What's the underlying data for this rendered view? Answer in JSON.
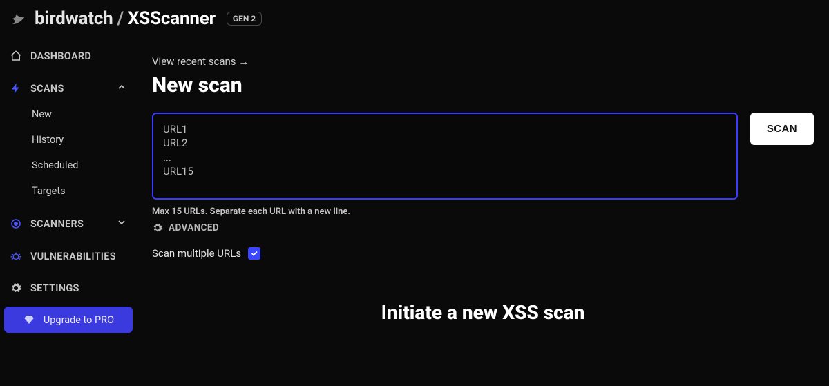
{
  "header": {
    "owner": "birdwatch",
    "separator": "/",
    "project": "XSScanner",
    "badge": "GEN 2"
  },
  "sidebar": {
    "dashboard": "DASHBOARD",
    "scans": {
      "label": "SCANS",
      "items": [
        "New",
        "History",
        "Scheduled",
        "Targets"
      ]
    },
    "scanners": "SCANNERS",
    "vulnerabilities": "VULNERABILITIES",
    "settings": "SETTINGS",
    "upgrade": "Upgrade to PRO"
  },
  "main": {
    "recent_link": "View recent scans →",
    "title": "New scan",
    "textarea_placeholder": "URL1\nURL2\n...\nURL15",
    "scan_button": "SCAN",
    "hint": "Max 15 URLs. Separate each URL with a new line.",
    "advanced_label": "ADVANCED",
    "multi_label": "Scan multiple URLs",
    "multi_checked": true,
    "hero": "Initiate a new XSS scan"
  },
  "icons": {
    "home": "home-icon",
    "bolt": "bolt-icon",
    "target": "target-icon",
    "bug": "bug-icon",
    "gear": "gear-icon",
    "diamond": "diamond-icon",
    "chevron_up": "chevron-up-icon",
    "chevron_down": "chevron-down-icon"
  }
}
